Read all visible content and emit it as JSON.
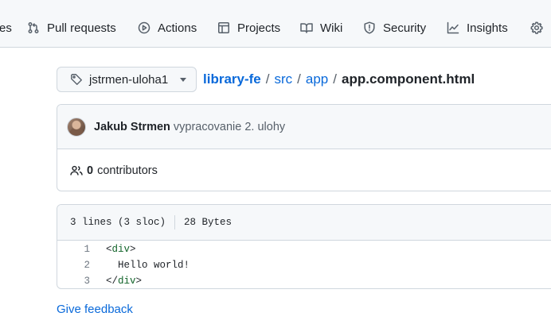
{
  "nav": {
    "items": [
      {
        "label": "es"
      },
      {
        "label": "Pull requests"
      },
      {
        "label": "Actions"
      },
      {
        "label": "Projects"
      },
      {
        "label": "Wiki"
      },
      {
        "label": "Security"
      },
      {
        "label": "Insights"
      }
    ]
  },
  "branch": {
    "name": "jstrmen-uloha1"
  },
  "breadcrumb": {
    "repo": "library-fe",
    "dir1": "src",
    "dir2": "app",
    "file": "app.component.html",
    "separator": "/"
  },
  "commit": {
    "author": "Jakub Strmen",
    "message": "vypracovanie 2. ulohy"
  },
  "contributors": {
    "count": "0",
    "label": "contributors"
  },
  "file": {
    "lines_info": "3 lines (3 sloc)",
    "size": "28 Bytes",
    "code": [
      {
        "num": "1",
        "text": "<div>"
      },
      {
        "num": "2",
        "text": "  Hello world!"
      },
      {
        "num": "3",
        "text": "</div>"
      }
    ]
  },
  "footer": {
    "feedback": "Give feedback"
  },
  "colors": {
    "link": "#0969da",
    "nav_bg": "#f6f8fa",
    "border": "#d0d7de",
    "tag_green": "#116329"
  }
}
